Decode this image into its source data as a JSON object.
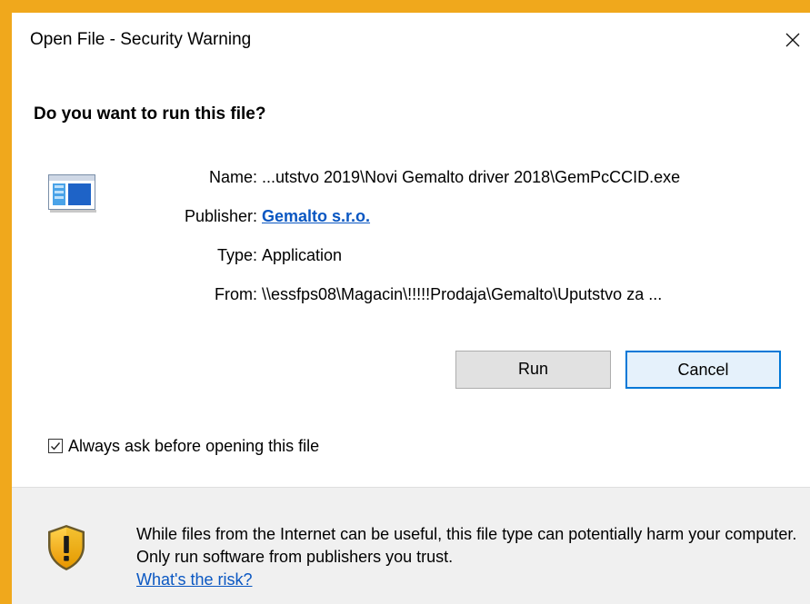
{
  "window": {
    "title": "Open File - Security Warning"
  },
  "dialog": {
    "question": "Do you want to run this file?",
    "fields": {
      "name_label": "Name:",
      "name_value": "...utstvo 2019\\Novi Gemalto driver 2018\\GemPcCCID.exe",
      "publisher_label": "Publisher:",
      "publisher_value": "Gemalto s.r.o.",
      "type_label": "Type:",
      "type_value": "Application",
      "from_label": "From:",
      "from_value": "\\\\essfps08\\Magacin\\!!!!!Prodaja\\Gemalto\\Uputstvo za ..."
    },
    "buttons": {
      "run": "Run",
      "cancel": "Cancel"
    },
    "checkbox": {
      "label": "Always ask before opening this file",
      "checked": true
    }
  },
  "footer": {
    "warning": "While files from the Internet can be useful, this file type can potentially harm your computer. Only run software from publishers you trust.",
    "risk_link": "What's the risk?"
  },
  "colors": {
    "window_border": "#f0a81c",
    "link": "#0a57c2",
    "focus_border": "#0078d7",
    "footer_bg": "#f0f0f0"
  }
}
